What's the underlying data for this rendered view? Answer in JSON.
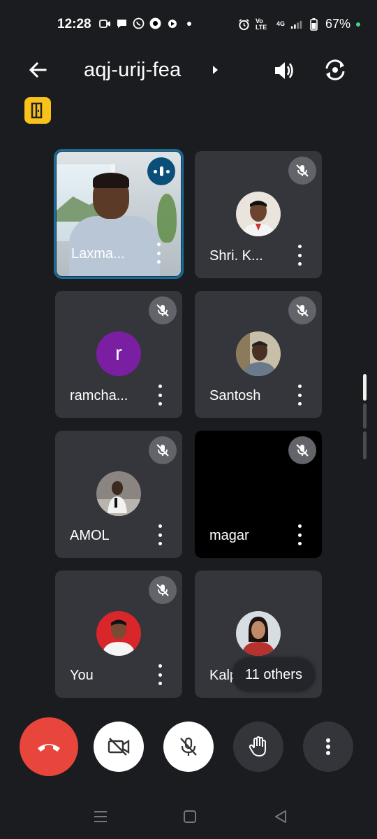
{
  "status_bar": {
    "time": "12:28",
    "network_label": "Vo LTE",
    "network_type": "4G",
    "battery": "67%",
    "icons": [
      "video-icon",
      "chat-icon",
      "whatsapp-icon",
      "circle-app-icon",
      "media-icon",
      "dot-icon",
      "alarm-icon",
      "signal-icon",
      "battery-icon"
    ]
  },
  "header": {
    "meeting_code": "aqj-urij-fea",
    "back_icon": "arrow-left-icon",
    "speaker_icon": "speaker-icon",
    "flip_icon": "camera-flip-icon"
  },
  "room_badge_icon": "door-icon",
  "participants": [
    {
      "name": "Laxma...",
      "type": "video",
      "speaking": true
    },
    {
      "name": "Shri. K...",
      "type": "photo",
      "muted": true
    },
    {
      "name": "ramcha...",
      "type": "letter",
      "initial": "r",
      "color": "#7b1fa2",
      "muted": true
    },
    {
      "name": "Santosh",
      "type": "photo",
      "muted": true
    },
    {
      "name": "AMOL",
      "type": "photo",
      "muted": true
    },
    {
      "name": "magar",
      "type": "none",
      "muted": true
    },
    {
      "name": "You",
      "type": "photo",
      "muted": true
    },
    {
      "name": "Kalpa",
      "type": "photo"
    }
  ],
  "others_label": "11 others",
  "controls": {
    "end_call_icon": "phone-hangup-icon",
    "camera_icon": "camera-off-icon",
    "mic_icon": "mic-off-icon",
    "hand_icon": "raise-hand-icon",
    "more_icon": "more-vertical-icon"
  },
  "colors": {
    "background": "#1b1c1f",
    "tile": "#34363b",
    "end_call": "#e8453c",
    "speaking_accent": "#0b4e78",
    "room_badge": "#f8c21a"
  }
}
